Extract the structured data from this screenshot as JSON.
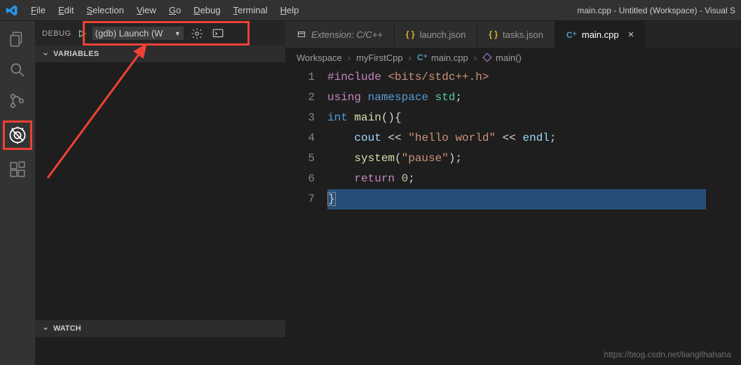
{
  "window_title": "main.cpp - Untitled (Workspace) - Visual S",
  "menu": [
    "File",
    "Edit",
    "Selection",
    "View",
    "Go",
    "Debug",
    "Terminal",
    "Help"
  ],
  "debug": {
    "label": "DEBUG",
    "config": "(gdb) Launch (W"
  },
  "sections": {
    "variables": "VARIABLES",
    "watch": "WATCH"
  },
  "tabs": [
    {
      "label": "Extension: C/C++",
      "italic": true,
      "icon": "ext"
    },
    {
      "label": "launch.json",
      "icon": "json"
    },
    {
      "label": "tasks.json",
      "icon": "json"
    },
    {
      "label": "main.cpp",
      "icon": "cpp",
      "active": true
    }
  ],
  "breadcrumb": {
    "a": "Workspace",
    "b": "myFirstCpp",
    "c": "main.cpp",
    "d": "main()"
  },
  "code": {
    "line_count": 7,
    "l1_kw": "#include",
    "l1_inc": "<bits/stdc++.h>",
    "l2_using": "using",
    "l2_ns": "namespace",
    "l2_std": "std",
    "l3_int": "int",
    "l3_main": "main",
    "l4_cout": "cout",
    "l4_str": "\"hello world\"",
    "l4_endl": "endl",
    "l5_sys": "system",
    "l5_arg": "\"pause\"",
    "l6_ret": "return",
    "l6_zero": "0"
  },
  "watermark": "https://blog.csdn.net/liangllhahaha"
}
